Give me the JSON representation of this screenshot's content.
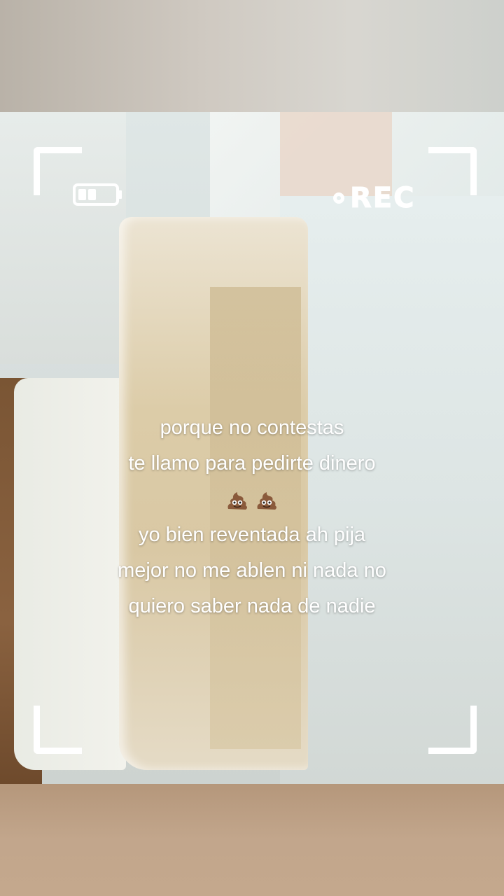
{
  "overlay": {
    "rec_label": "REC",
    "battery_icon": "battery-half-icon",
    "record_dot_icon": "record-dot-icon"
  },
  "caption": {
    "line1": "porque no contestas",
    "line2": "te llamo para pedirte dinero",
    "emoji": [
      "💩",
      "💩"
    ],
    "emoji_icon": "poop-emoji-icon",
    "line3": "yo bien reventada ah pija",
    "line4": "mejor no me ablen ni nada no",
    "line5": "quiero saber nada de nadie"
  },
  "colors": {
    "overlay_white": "#ffffff",
    "poo_brown": "#8a5a3b"
  }
}
